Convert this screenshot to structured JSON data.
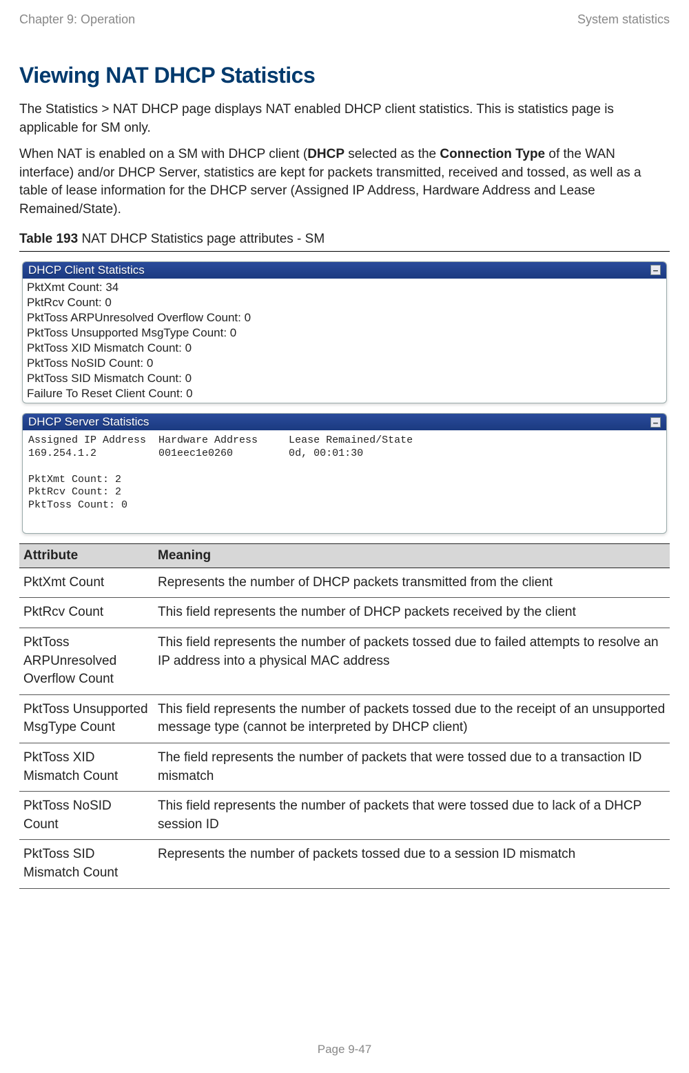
{
  "header": {
    "left": "Chapter 9:  Operation",
    "right": "System statistics"
  },
  "title": "Viewing NAT DHCP Statistics",
  "para1_plain": "The Statistics > NAT DHCP page displays NAT enabled DHCP client statistics. This is statistics page is applicable for SM only.",
  "para2": {
    "t1": "When NAT is enabled on a SM with DHCP client (",
    "b1": "DHCP",
    "t2": " selected as the ",
    "b2": "Connection Type",
    "t3": " of the WAN interface) and/or DHCP Server, statistics are kept for packets transmitted, received and tossed, as well as a table of lease information for the DHCP server (Assigned IP Address, Hardware Address and Lease Remained/State)."
  },
  "table_caption": {
    "b": "Table 193",
    "rest": " NAT DHCP Statistics page attributes - SM"
  },
  "panels": {
    "client": {
      "title": "DHCP Client Statistics",
      "lines": [
        "PktXmt Count: 34",
        "PktRcv Count: 0",
        "PktToss ARPUnresolved Overflow Count: 0",
        "PktToss Unsupported MsgType Count: 0",
        "PktToss XID Mismatch Count: 0",
        "PktToss NoSID Count: 0",
        "PktToss SID Mismatch Count: 0",
        "Failure To Reset Client Count: 0"
      ]
    },
    "server": {
      "title": "DHCP Server Statistics",
      "mono": "Assigned IP Address  Hardware Address     Lease Remained/State\n169.254.1.2          001eec1e0260         0d, 00:01:30\n\nPktXmt Count: 2\nPktRcv Count: 2\nPktToss Count: 0"
    }
  },
  "attr_table": {
    "headers": {
      "a": "Attribute",
      "m": "Meaning"
    },
    "rows": [
      {
        "a": "PktXmt Count",
        "m": "Represents the number of DHCP packets transmitted from the client"
      },
      {
        "a": "PktRcv Count",
        "m": "This field represents the number of DHCP packets received by the client"
      },
      {
        "a": "PktToss ARPUnresolved Overflow Count",
        "m": "This field represents the number of packets tossed due to failed attempts to resolve an IP address into a physical MAC address"
      },
      {
        "a": "PktToss Unsupported MsgType Count",
        "m": "This field represents the number of packets tossed due to the receipt of an unsupported message type (cannot be interpreted by DHCP client)"
      },
      {
        "a": "PktToss XID Mismatch Count",
        "m": "The field represents the number of packets that were tossed due to a transaction ID mismatch"
      },
      {
        "a": "PktToss NoSID Count",
        "m": "This field represents the number of packets that were tossed due to lack of a DHCP session ID"
      },
      {
        "a": "PktToss SID Mismatch Count",
        "m": "Represents the number of packets tossed due to a session ID mismatch"
      }
    ]
  },
  "footer": "Page 9-47"
}
